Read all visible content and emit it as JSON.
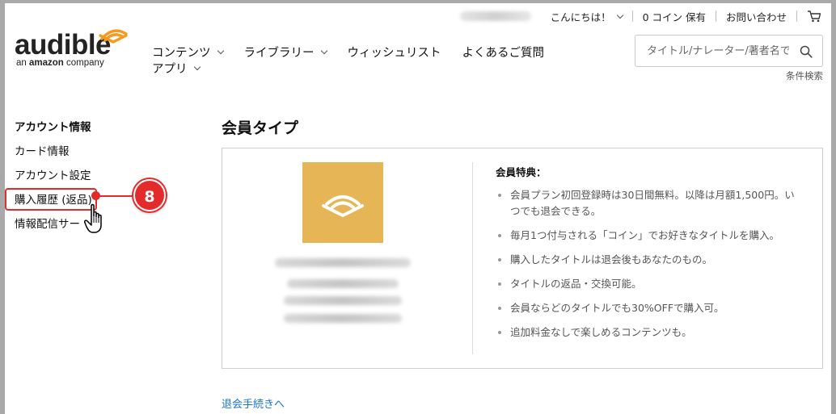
{
  "header": {
    "greeting": "こんにちは！",
    "coins": "0 コイン 保有",
    "help": "お問い合わせ"
  },
  "logo": {
    "word": "audible",
    "sub_prefix": "an",
    "sub_brand": "amazon",
    "sub_suffix": "company"
  },
  "nav": {
    "items": [
      {
        "label": "コンテンツ",
        "dropdown": true
      },
      {
        "label": "ライブラリー",
        "dropdown": true
      },
      {
        "label": "ウィッシュリスト",
        "dropdown": false
      },
      {
        "label": "よくあるご質問",
        "dropdown": false
      }
    ],
    "apps": {
      "label": "アプリ",
      "dropdown": true
    }
  },
  "search": {
    "placeholder": "タイトル/ナレーター/著者名で",
    "advanced": "条件検索"
  },
  "sidebar": {
    "heading": "アカウント情報",
    "items": [
      {
        "label": "カード情報"
      },
      {
        "label": "アカウント設定"
      },
      {
        "label": "購入履歴 (返品)"
      },
      {
        "label": "情報配信サー"
      }
    ]
  },
  "annotation": {
    "step_number": "8",
    "color": "#e32b2b"
  },
  "main": {
    "title": "会員タイプ",
    "benefits_heading": "会員特典：",
    "benefits": [
      "会員プラン初回登録時は30日間無料。以降は月額1,500円。いつでも退会できる。",
      "毎月1つ付与される「コイン」でお好きなタイトルを購入。",
      "購入したタイトルは退会後もあなたのもの。",
      "タイトルの返品・交換可能。",
      "会員ならどのタイトルでも30%OFFで購入可。",
      "追加料金なしで楽しめるコンテンツも。"
    ],
    "cancel_link": "退会手続きへ"
  },
  "colors": {
    "brand_orange": "#f7991c",
    "plan_tile": "#e6b656",
    "link": "#1a73c8",
    "highlight": "#e32b2b"
  }
}
